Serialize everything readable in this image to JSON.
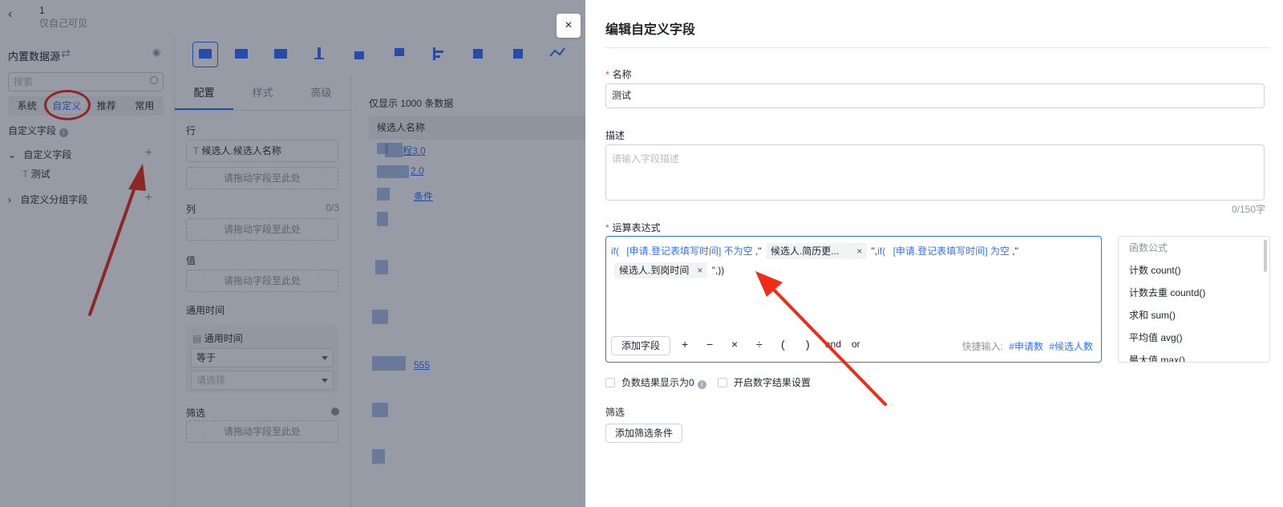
{
  "app": {
    "title": "1",
    "subtitle": "仅自己可见",
    "datasource_title": "内置数据源",
    "search_placeholder": "搜索",
    "source_tabs": [
      "系统",
      "自定义",
      "推荐",
      "常用"
    ],
    "custom_fields_heading": "自定义字段",
    "tree": {
      "group1": "自定义字段",
      "child1": "测试",
      "group2": "自定义分组字段"
    },
    "config_tabs": [
      "配置",
      "样式",
      "高级"
    ],
    "row_label": "行",
    "row_field": "候选人.候选人名称",
    "drop_hint": "请拖动字段至此处",
    "col_label": "列",
    "col_count": "0/3",
    "value_label": "值",
    "time_label": "通用时间",
    "time_field": "通用时间",
    "time_op": "等于",
    "time_placeholder": "请选择",
    "filter_label": "筛选",
    "data_hint": "仅显示 1000 条数据",
    "table_header": "候选人名称",
    "links": [
      "程3.0",
      "2.0",
      "条件",
      "555"
    ]
  },
  "drawer": {
    "title": "编辑自定义字段",
    "name_label": "名称",
    "name_value": "测试",
    "desc_label": "描述",
    "desc_placeholder": "请输入字段描述",
    "desc_counter": "0/150字",
    "expr_label": "运算表达式",
    "expr": {
      "if1": "if(",
      "field1": "[申请.登记表填写时间] 不为空",
      "sep1": ",\"",
      "tag1": "候选人.简历更...",
      "sep2": "\",",
      "if2": "if(",
      "field2": "[申请.登记表填写时间] 为空",
      "sep3": ",\"",
      "tag2": "候选人.到岗时间",
      "end": "\",))"
    },
    "add_field_button": "添加字段",
    "operators": [
      "+",
      "−",
      "×",
      "÷",
      "(",
      ")",
      "and",
      "or"
    ],
    "quick_label": "快捷输入:",
    "quick_tags": [
      "#申请数",
      "#候选人数"
    ],
    "functions_header": "函数公式",
    "functions": [
      "计数 count()",
      "计数去重 countd()",
      "求和 sum()",
      "平均值 avg()",
      "最大值 max()"
    ],
    "checkbox1": "负数结果显示为0",
    "checkbox2": "开启数字结果设置",
    "filter_label": "筛选",
    "add_filter_button": "添加筛选条件",
    "close_symbol": "×"
  },
  "colors": {
    "accent": "#3370ff",
    "annotation": "#ef2c18",
    "overlay": "rgba(22,33,56,0.45)"
  }
}
